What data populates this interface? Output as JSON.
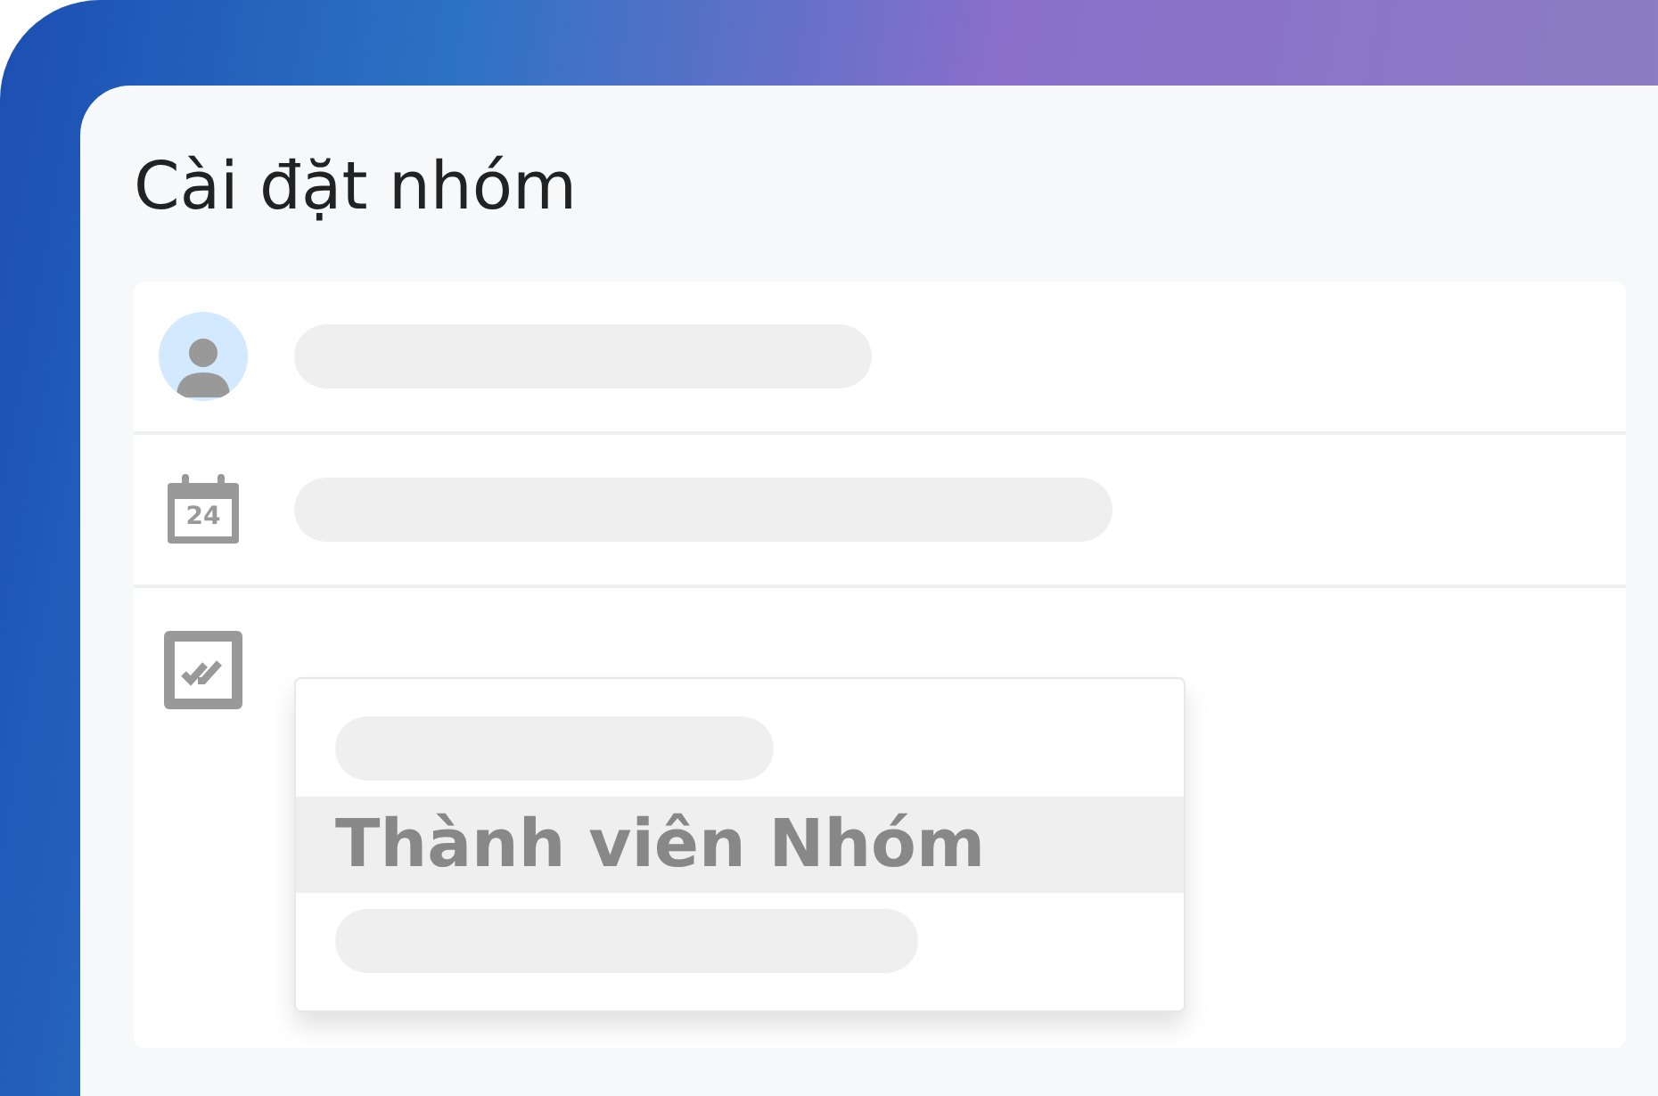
{
  "title": "Cài đặt nhóm",
  "rows": [
    {
      "kind": "avatar"
    },
    {
      "kind": "calendar",
      "day": "24"
    },
    {
      "kind": "dropdown"
    }
  ],
  "dropdown": {
    "items": [
      {
        "kind": "placeholder",
        "selected": false
      },
      {
        "kind": "text",
        "label": "Thành viên Nhóm",
        "selected": true
      },
      {
        "kind": "placeholder",
        "selected": false
      }
    ]
  }
}
